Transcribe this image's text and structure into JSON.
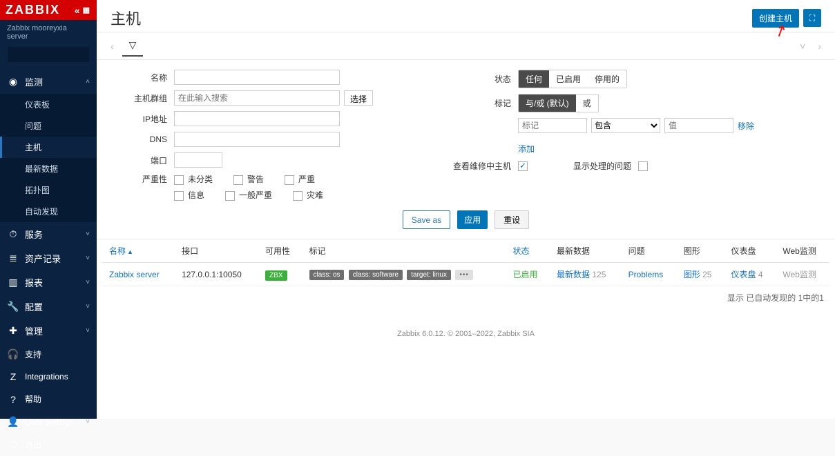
{
  "brand": "ZABBIX",
  "server_name": "Zabbix mooreyxia server",
  "search_placeholder": "",
  "sidebar": {
    "groups": [
      {
        "id": "monitor",
        "icon": "◉",
        "label": "监测",
        "expanded": true,
        "caret": "˄",
        "items": [
          {
            "label": "仪表板",
            "active": false
          },
          {
            "label": "问题",
            "active": false
          },
          {
            "label": "主机",
            "active": true
          },
          {
            "label": "最新数据",
            "active": false
          },
          {
            "label": "拓扑图",
            "active": false
          },
          {
            "label": "自动发现",
            "active": false
          }
        ]
      },
      {
        "id": "services",
        "icon": "⏱",
        "label": "服务",
        "caret": "˅"
      },
      {
        "id": "inventory",
        "icon": "≣",
        "label": "资产记录",
        "caret": "˅"
      },
      {
        "id": "reports",
        "icon": "▥",
        "label": "报表",
        "caret": "˅"
      },
      {
        "id": "config",
        "icon": "🔧",
        "label": "配置",
        "caret": "˅"
      },
      {
        "id": "admin",
        "icon": "✚",
        "label": "管理",
        "caret": "˅"
      }
    ],
    "bottom": [
      {
        "icon": "🎧",
        "label": "支持"
      },
      {
        "icon": "Z",
        "label": "Integrations"
      },
      {
        "icon": "?",
        "label": "帮助"
      },
      {
        "icon": "👤",
        "label": "User settings",
        "caret": "˅"
      },
      {
        "icon": "⏻",
        "label": "退出"
      }
    ]
  },
  "page": {
    "title": "主机",
    "create_btn": "创建主机"
  },
  "filter": {
    "left_labels": {
      "name": "名称",
      "host_group": "主机群组",
      "ip": "IP地址",
      "dns": "DNS",
      "port": "端口",
      "severity": "严重性"
    },
    "host_group_placeholder": "在此输入搜索",
    "select_btn": "选择",
    "severity_opts": [
      "未分类",
      "警告",
      "严重",
      "信息",
      "一般严重",
      "灾难"
    ],
    "right_labels": {
      "status": "状态",
      "tags": "标记",
      "maintenance": "查看维修中主机",
      "show_suppressed": "显示处理的问题"
    },
    "status_opts": [
      "任何",
      "已启用",
      "停用的"
    ],
    "status_selected": 0,
    "tag_eval_opts": [
      "与/或 (默认)",
      "或"
    ],
    "tag_eval_selected": 0,
    "tag_key_placeholder": "标记",
    "tag_op_options": [
      "包含"
    ],
    "tag_val_placeholder": "值",
    "tag_remove": "移除",
    "tag_add": "添加",
    "maintenance_checked": true,
    "suppressed_checked": false,
    "actions": {
      "save_as": "Save as",
      "apply": "应用",
      "reset": "重设"
    }
  },
  "table": {
    "headers": {
      "name": "名称",
      "interface": "接口",
      "availability": "可用性",
      "tags": "标记",
      "status": "状态",
      "latest": "最新数据",
      "problems": "问题",
      "graphs": "图形",
      "dashboards": "仪表盘",
      "web": "Web监测"
    },
    "sort_col": "name",
    "rows": [
      {
        "name": "Zabbix server",
        "interface": "127.0.0.1:10050",
        "availability_badge": "ZBX",
        "tags": [
          "class: os",
          "class: software",
          "target: linux"
        ],
        "tags_more": "•••",
        "status": "已启用",
        "latest_link": "最新数据",
        "latest_count": "125",
        "problems_link": "Problems",
        "graphs_link": "图形",
        "graphs_count": "25",
        "dash_link": "仪表盘",
        "dash_count": "4",
        "web": "Web监测"
      }
    ],
    "footer": "显示 已自动发现的 1中的1"
  },
  "page_footer": "Zabbix 6.0.12. © 2001–2022, Zabbix SIA"
}
